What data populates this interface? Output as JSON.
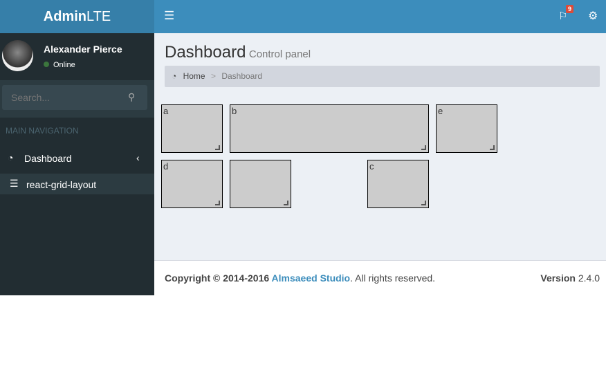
{
  "logo": {
    "bold": "Admin",
    "light": "LTE"
  },
  "navbar": {
    "notification_count": "9"
  },
  "user": {
    "name": "Alexander Pierce",
    "status": "Online"
  },
  "search": {
    "placeholder": "Search..."
  },
  "nav": {
    "header": "MAIN NAVIGATION",
    "items": [
      {
        "label": "Dashboard"
      },
      {
        "label": "react-grid-layout"
      }
    ]
  },
  "page": {
    "title": "Dashboard",
    "subtitle": "Control panel"
  },
  "breadcrumb": {
    "home": "Home",
    "current": "Dashboard"
  },
  "grid": {
    "items": [
      "a",
      "b",
      "e",
      "d",
      "",
      "c"
    ]
  },
  "footer": {
    "copyright": "Copyright © 2014-2016 ",
    "company": "Almsaeed Studio",
    "rights": ". All rights reserved.",
    "version_label": "Version",
    "version": " 2.4.0"
  },
  "colors": {
    "brand": "#3c8dbc",
    "sidebar": "#222d32",
    "badge": "#dd4b39",
    "online": "#3c763d"
  }
}
